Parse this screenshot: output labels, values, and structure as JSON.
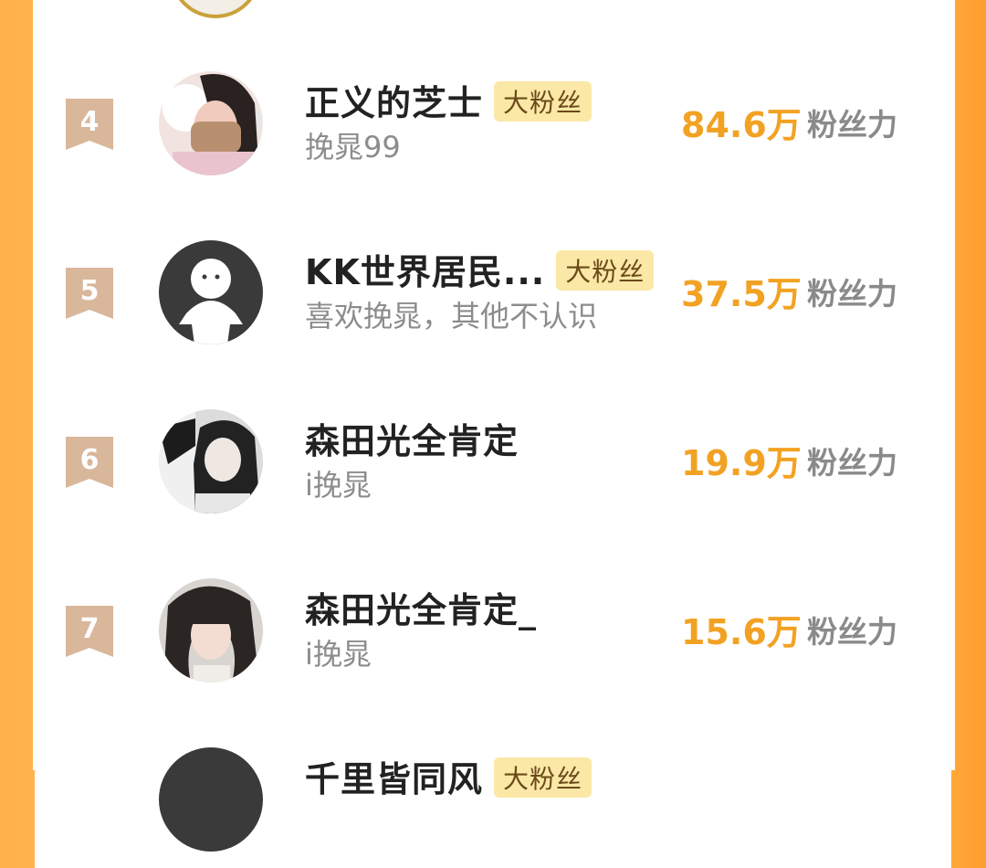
{
  "colors": {
    "frame": "#ffb24a",
    "score": "#f2a223",
    "tag_bg": "#fbe8a6",
    "badge": "#d9b79b"
  },
  "rows": [
    {
      "rank": "4",
      "name": "正义的芝士",
      "tag": "大粉丝",
      "subtitle": "挽晁99",
      "score": "84.6万",
      "unit": "粉丝力",
      "avatar": "girl-with-earmuffs"
    },
    {
      "rank": "5",
      "name": "KK世界居民...",
      "tag": "大粉丝",
      "subtitle": "喜欢挽晁，其他不认识",
      "score": "37.5万",
      "unit": "粉丝力",
      "avatar": "default-avatar"
    },
    {
      "rank": "6",
      "name": "森田光全肯定",
      "tag": "",
      "subtitle": "i挽晁",
      "score": "19.9万",
      "unit": "粉丝力",
      "avatar": "girl-photo"
    },
    {
      "rank": "7",
      "name": "森田光全肯定_",
      "tag": "",
      "subtitle": "i挽晁",
      "score": "15.6万",
      "unit": "粉丝力",
      "avatar": "girl-photo"
    }
  ],
  "partial_bottom": {
    "name": "千里皆同风",
    "tag": "大粉丝"
  }
}
